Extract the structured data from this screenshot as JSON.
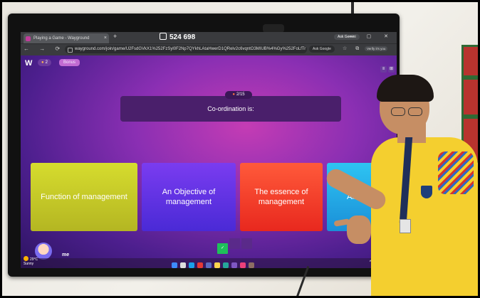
{
  "browser": {
    "tab_title": "Playing a Game - Wayground",
    "tab_close": "×",
    "new_tab": "+",
    "join_code": "524 698",
    "ask_gemini": "Ask Gemini",
    "window_controls": "— ▢ ✕",
    "nav": "← → ⟳",
    "url": "wayground.com/join/game/U2FsdGVkX1%252FzSyl0F2Np7QYkhLAtaHwerD1QRelv2c6vqntO3MIUB%4%Gy%252FoLfTr",
    "ask_google": "Ask Google",
    "tool_icons": "☆ ⧉ ⋮",
    "verify": "Verify it's you"
  },
  "game": {
    "logo": "W",
    "streak": "2",
    "bonus": "Bonus",
    "top_right_buttons": [
      "≡",
      "⊞"
    ],
    "question_counter": "2/15",
    "question": "Co-ordination is:",
    "answers": [
      {
        "label": "Function of management",
        "color": "#d6dc2e"
      },
      {
        "label": "An Objective of management",
        "color": "#7a3cf0"
      },
      {
        "label": "The essence of management",
        "color": "#ff5a3a"
      },
      {
        "label": "All of these",
        "color": "#2ec4f2"
      }
    ],
    "progress": {
      "answered": 1,
      "total_visible": 3,
      "first_label": "✓"
    },
    "player_name": "me"
  },
  "taskbar": {
    "weather_temp": "29°C",
    "weather_desc": "Sunny",
    "tray": "^ ⌁ 🔊"
  }
}
